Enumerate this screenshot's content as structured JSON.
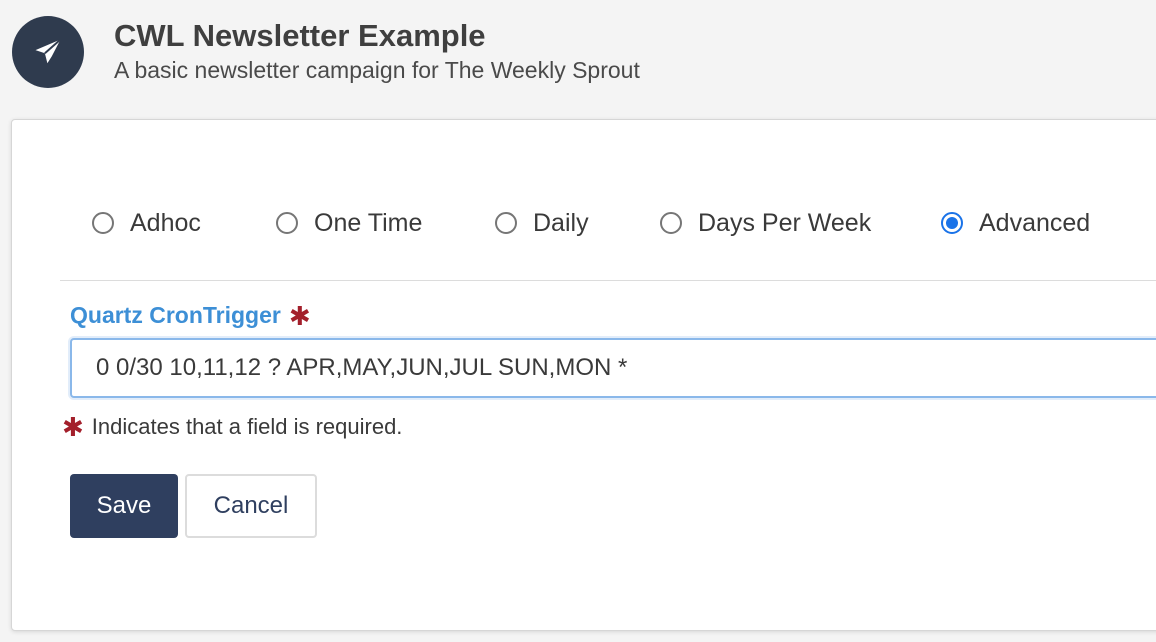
{
  "header": {
    "icon": "paper-plane-icon",
    "title": "CWL Newsletter Example",
    "subtitle": "A basic newsletter campaign for The Weekly Sprout"
  },
  "schedule": {
    "options": [
      {
        "label": "Adhoc",
        "checked": false
      },
      {
        "label": "One Time",
        "checked": false
      },
      {
        "label": "Daily",
        "checked": false
      },
      {
        "label": "Days Per Week",
        "checked": false
      },
      {
        "label": "Advanced",
        "checked": true
      }
    ]
  },
  "cron_field": {
    "label": "Quartz CronTrigger",
    "required_marker": "✱",
    "value": "0 0/30 10,11,12 ? APR,MAY,JUN,JUL SUN,MON *"
  },
  "required_note": {
    "marker": "✱",
    "text": "Indicates that a field is required."
  },
  "actions": {
    "save_label": "Save",
    "cancel_label": "Cancel"
  },
  "colors": {
    "header_icon_bg": "#2f3b4e",
    "accent_blue": "#1a73e8",
    "label_blue": "#3d8fd6",
    "required_red": "#a31f2b",
    "primary_button": "#2f3f5f"
  }
}
